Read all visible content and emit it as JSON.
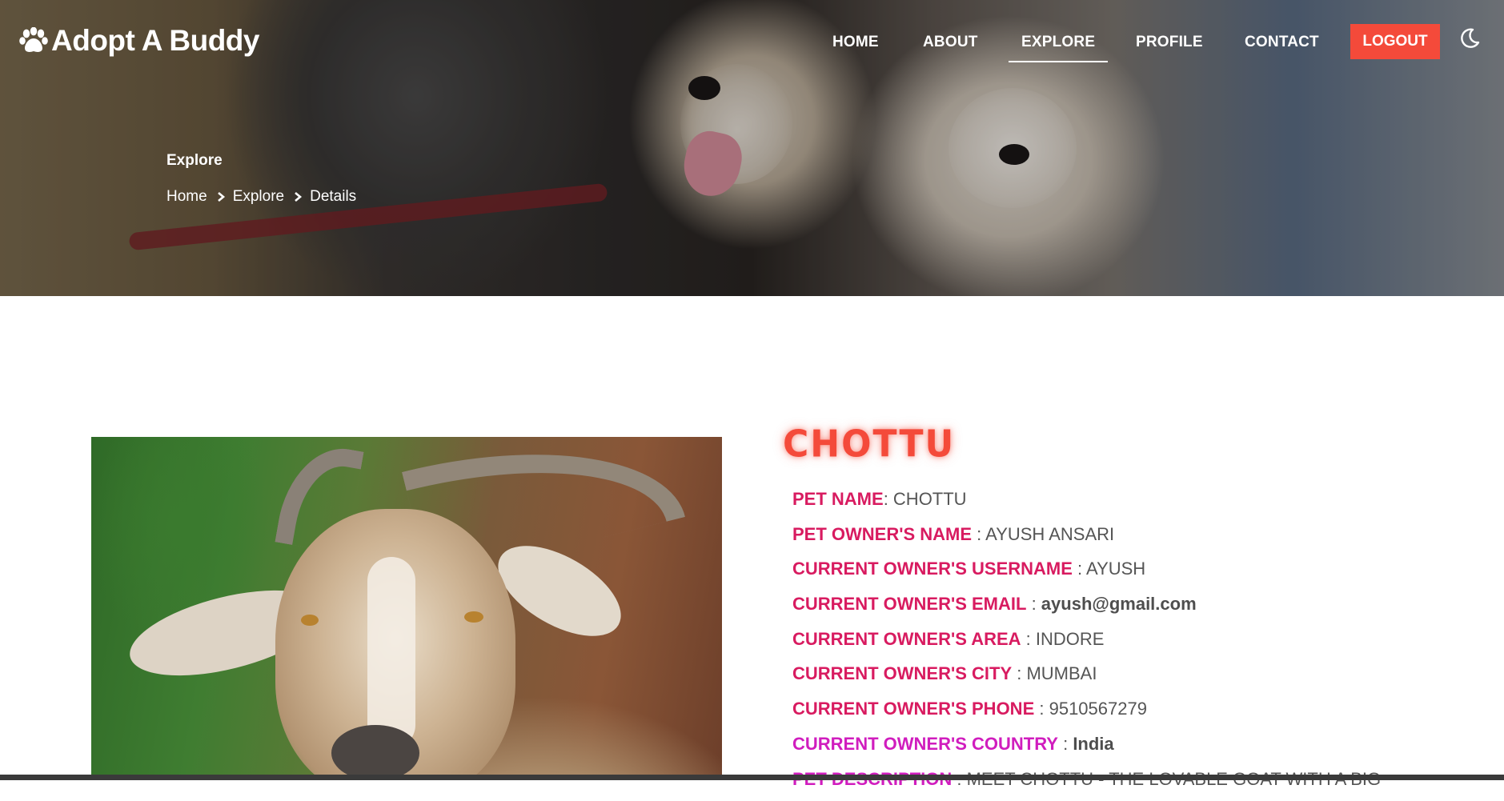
{
  "brand": {
    "name": "Adopt A Buddy"
  },
  "nav": {
    "items": [
      {
        "label": "HOME"
      },
      {
        "label": "ABOUT"
      },
      {
        "label": "EXPLORE",
        "active": true
      },
      {
        "label": "PROFILE"
      },
      {
        "label": "CONTACT"
      }
    ],
    "logout_label": "LOGOUT",
    "theme_toggle_icon": "moon-icon"
  },
  "hero": {
    "title": "Explore",
    "breadcrumb": [
      "Home",
      "Explore",
      "Details"
    ]
  },
  "pet": {
    "heading": "CHOTTU",
    "details": [
      {
        "label": "PET NAME",
        "sep": ": ",
        "value": "CHOTTU"
      },
      {
        "label": "PET OWNER'S NAME",
        "sep": " : ",
        "value": "AYUSH ANSARI"
      },
      {
        "label": "CURRENT OWNER'S USERNAME",
        "sep": " : ",
        "value": "AYUSH"
      },
      {
        "label": "CURRENT OWNER'S EMAIL",
        "sep": " : ",
        "value": "ayush@gmail.com"
      },
      {
        "label": "CURRENT OWNER'S AREA",
        "sep": " : ",
        "value": "INDORE"
      },
      {
        "label": "CURRENT OWNER'S CITY",
        "sep": " : ",
        "value": "MUMBAI"
      },
      {
        "label": "CURRENT OWNER'S PHONE",
        "sep": " : ",
        "value": "9510567279"
      },
      {
        "label": "CURRENT OWNER'S COUNTRY",
        "sep": " : ",
        "value": "India"
      },
      {
        "label": "PET DESCRIPTION",
        "sep": " : ",
        "value": "MEET CHOTTU - THE LOVABLE GOAT WITH A BIG"
      }
    ]
  },
  "colors": {
    "accent": "#f44a3a",
    "label": "#d81b60",
    "label_alt": "#d01dbe",
    "value": "#555555"
  }
}
